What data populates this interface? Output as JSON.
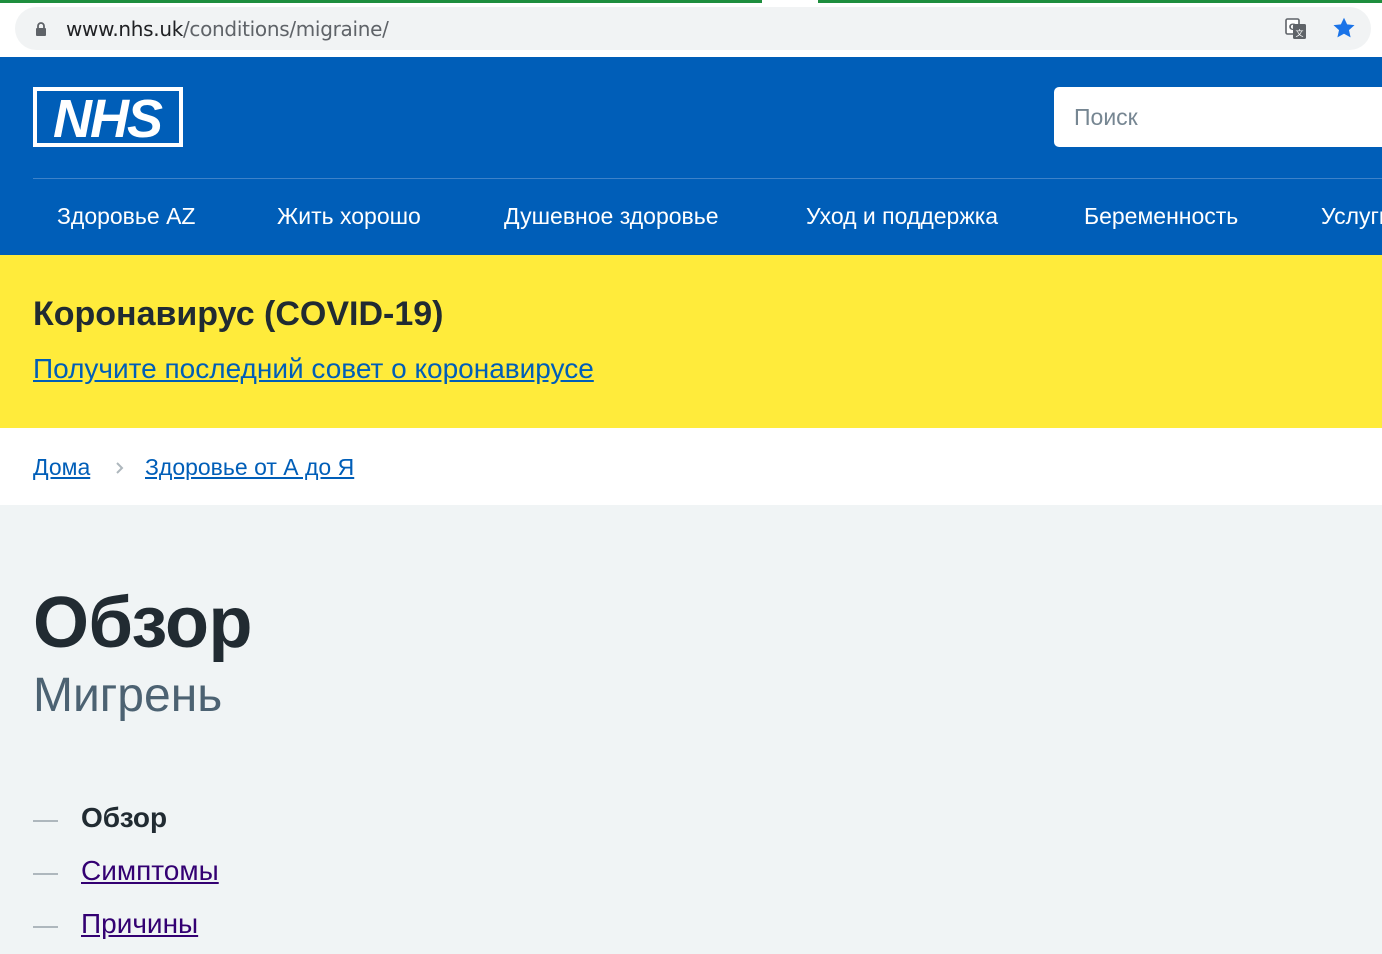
{
  "browser": {
    "url_host": "www.nhs.uk",
    "url_path": "/conditions/migraine/"
  },
  "header": {
    "logo_text": "NHS",
    "search_placeholder": "Поиск",
    "nav": [
      {
        "label": "Здоровье AZ"
      },
      {
        "label": "Жить хорошо"
      },
      {
        "label": "Душевное здоровье"
      },
      {
        "label": "Уход и поддержка"
      },
      {
        "label": "Беременность"
      },
      {
        "label": "Услуги"
      }
    ]
  },
  "banner": {
    "title": "Коронавирус (COVID-19)",
    "link": "Получите последний совет о коронавирусе"
  },
  "breadcrumb": {
    "home": "Дома",
    "section": "Здоровье от А до Я"
  },
  "page": {
    "title": "Обзор",
    "subtitle": "Мигрень"
  },
  "contents": [
    {
      "label": "Обзор",
      "current": true
    },
    {
      "label": "Симптомы",
      "current": false
    },
    {
      "label": "Причины",
      "current": false
    }
  ],
  "colors": {
    "nhs_blue": "#005eb8",
    "banner_yellow": "#ffeb3b",
    "visited_link": "#330072",
    "page_bg": "#f0f4f5"
  }
}
